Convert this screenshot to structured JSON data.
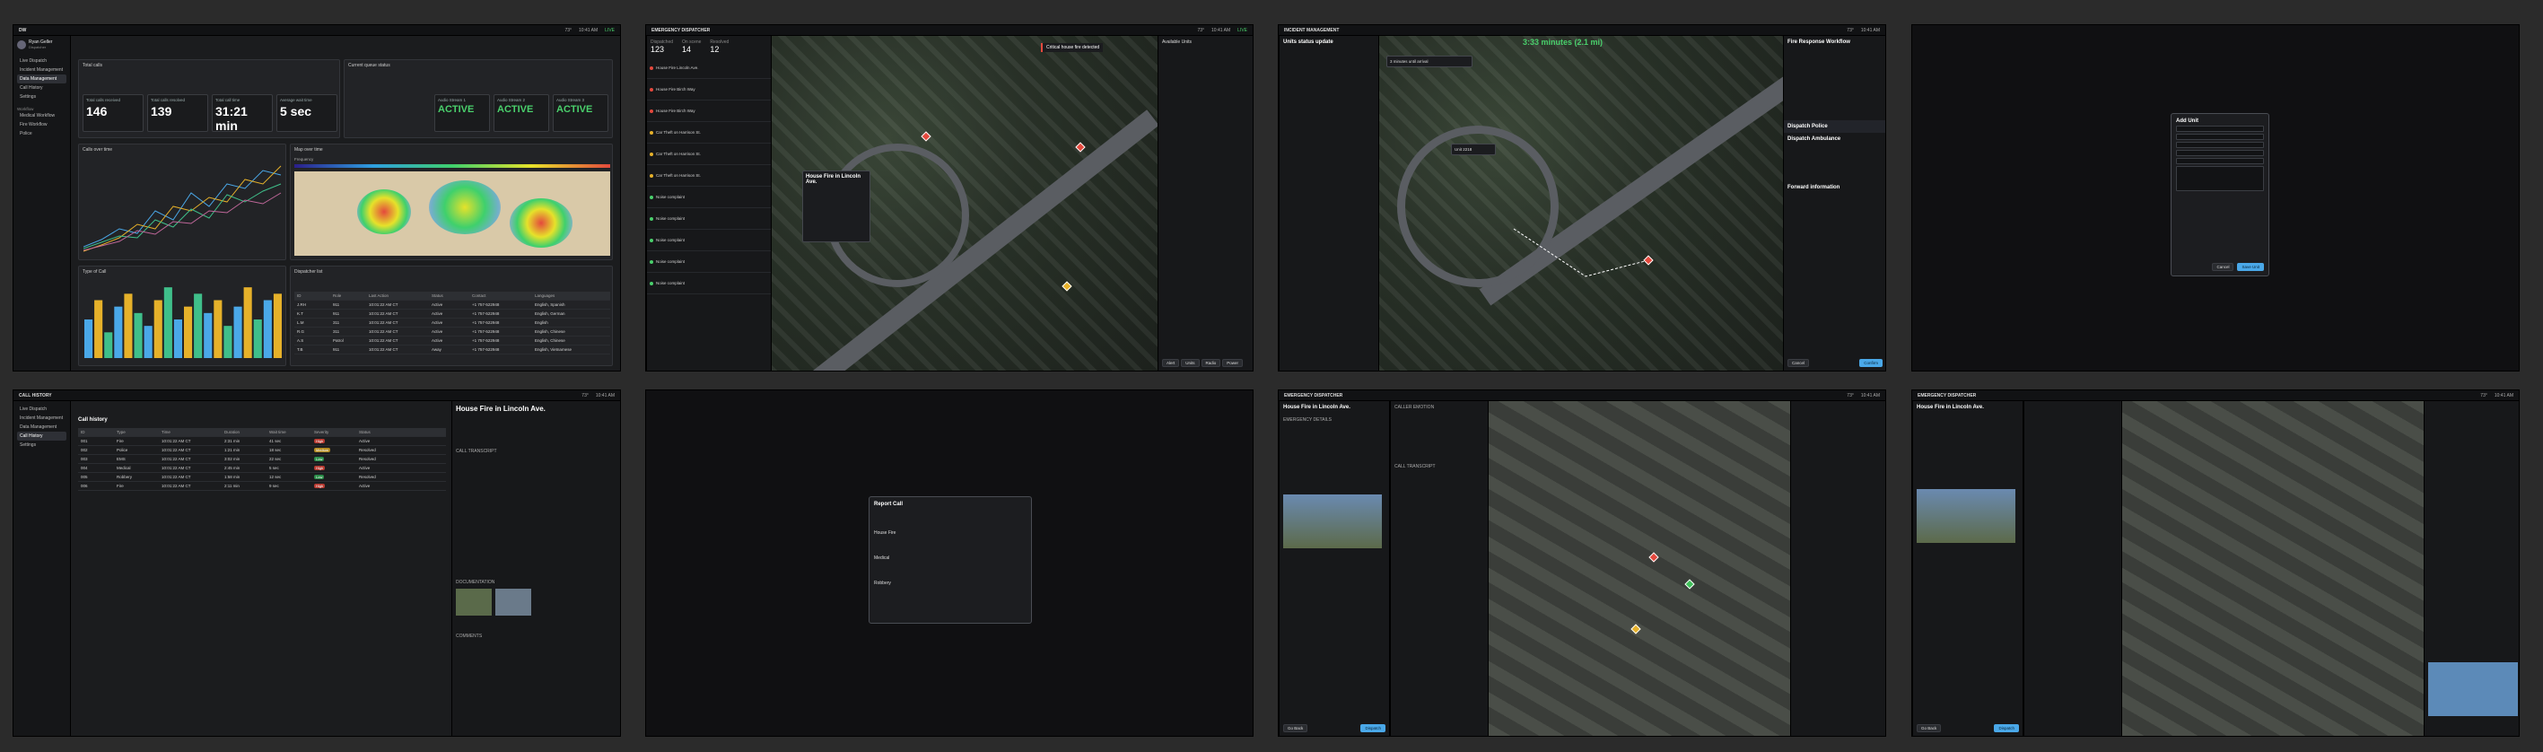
{
  "tiles": {
    "t1": {
      "window_title": "DW",
      "user": {
        "name": "Ryan Geller",
        "role": "Dispatcher"
      },
      "nav": [
        "Live Dispatch",
        "Incident Management",
        "Data Management",
        "Call History",
        "Settings"
      ],
      "nav_section": "Workflow",
      "nav_sub": [
        "Medical Workflow",
        "Fire Workflow",
        "Police"
      ],
      "header_left": "Total calls",
      "header_right": "Current queue status",
      "kpis": [
        {
          "label": "Total calls received",
          "value": "146"
        },
        {
          "label": "Total calls resolved",
          "value": "139"
        },
        {
          "label": "Total call time",
          "value": "31:21 min"
        },
        {
          "label": "Average wait time",
          "value": "5 sec"
        }
      ],
      "queues": [
        {
          "label": "Audio Stream 1",
          "value": "ACTIVE"
        },
        {
          "label": "Audio Stream 2",
          "value": "ACTIVE"
        },
        {
          "label": "Audio Stream 3",
          "value": "ACTIVE"
        }
      ],
      "chart1_title": "Calls over time",
      "chart2_title": "Type of Call",
      "heatmap_title": "Map over time",
      "heatmap_legend": "Frequency",
      "table_title": "Dispatcher list",
      "table_headers": [
        "ID",
        "Role",
        "Last Action",
        "Status",
        "Contact",
        "Languages"
      ],
      "table_rows": [
        [
          "J.RH",
          "911",
          "10:01:22 AM CT",
          "Active",
          "+1 757-522948",
          "English, Spanish"
        ],
        [
          "K.T",
          "911",
          "10:01:22 AM CT",
          "Active",
          "+1 757-522948",
          "English, German"
        ],
        [
          "L.M",
          "311",
          "10:01:22 AM CT",
          "Active",
          "+1 757-522948",
          "English"
        ],
        [
          "R.G",
          "311",
          "10:01:22 AM CT",
          "Active",
          "+1 757-522948",
          "English, Chinese"
        ],
        [
          "A.S",
          "Patrol",
          "10:01:22 AM CT",
          "Active",
          "+1 757-522948",
          "English, Chinese"
        ],
        [
          "T.B",
          "911",
          "10:01:22 AM CT",
          "Away",
          "+1 757-522948",
          "English, Vietnamese"
        ]
      ]
    },
    "t2": {
      "window_title": "EMERGENCY DISPATCHER",
      "stat_labels": [
        "Dispatched",
        "On scene",
        "Resolved"
      ],
      "stat_values": [
        "123",
        "14",
        "12"
      ],
      "alert": "Critical house fire detected",
      "popup_title": "House Fire in Lincoln Ave.",
      "incidents": [
        "House Fire Lincoln Ave.",
        "House Fire Birch Way",
        "House Fire Birch Way",
        "Car Theft on Harrison St.",
        "Car Theft on Harrison St.",
        "Car Theft on Harrison St.",
        "Noise complaint",
        "Noise complaint",
        "Noise complaint",
        "Noise complaint",
        "Noise complaint"
      ],
      "units_title": "Available Units",
      "footer_buttons": [
        "Alert",
        "Units",
        "Radio",
        "Power",
        "Settings"
      ]
    },
    "t3": {
      "window_title": "INCIDENT MANAGEMENT",
      "status_update": "Units status update",
      "eta": "3:33 minutes (2.1 mi)",
      "unit_arrival": "3 minutes until arrival",
      "unit_label": "Unit 2218",
      "workflow_title": "Fire Response Workflow",
      "dispatch": "Dispatch Police",
      "ambulance": "Dispatch Ambulance",
      "forward": "Forward information",
      "btn_cancel": "Cancel",
      "btn_confirm": "Confirm"
    },
    "t4": {
      "modal_title": "Add Unit",
      "btn_cancel": "Cancel",
      "btn_save": "Save Unit"
    },
    "t5": {
      "window_title": "CALL HISTORY",
      "list_title": "Call history",
      "headers": [
        "ID",
        "Type",
        "Time",
        "Duration",
        "Wait time",
        "Severity",
        "Status"
      ],
      "rows": [
        [
          "001",
          "Fire",
          "10:01:22 AM CT",
          "2:31 min",
          "41 sec",
          "High",
          "Active"
        ],
        [
          "002",
          "Police",
          "10:01:22 AM CT",
          "1:21 min",
          "18 sec",
          "Medium",
          "Resolved"
        ],
        [
          "003",
          "EMS",
          "10:01:22 AM CT",
          "3:02 min",
          "22 sec",
          "Low",
          "Resolved"
        ],
        [
          "004",
          "Medical",
          "10:01:22 AM CT",
          "2:45 min",
          "5 sec",
          "High",
          "Active"
        ],
        [
          "005",
          "Robbery",
          "10:01:22 AM CT",
          "1:58 min",
          "12 sec",
          "Low",
          "Resolved"
        ],
        [
          "006",
          "Fire",
          "10:01:22 AM CT",
          "2:11 min",
          "9 sec",
          "High",
          "Active"
        ]
      ],
      "detail_title": "House Fire in Lincoln Ave.",
      "transcript": "CALL TRANSCRIPT",
      "documentation": "DOCUMENTATION",
      "comments": "COMMENTS"
    },
    "t6": {
      "modal_title": "Report Call",
      "items": [
        "House Fire",
        "Medical",
        "Robbery"
      ]
    },
    "t7": {
      "window_title": "EMERGENCY DISPATCHER",
      "title": "House Fire in Lincoln Ave.",
      "section1": "EMERGENCY DETAILS",
      "section2": "CALLER EMOTION",
      "section3": "CALL TRANSCRIPT",
      "btn_cancel": "Go Back",
      "btn_submit": "Dispatch"
    },
    "t8": {
      "window_title": "EMERGENCY DISPATCHER",
      "title": "House Fire in Lincoln Ave.",
      "btn_cancel": "Go Back",
      "btn_submit": "Dispatch"
    }
  },
  "topbar": {
    "weather": "73°",
    "time": "10:41 AM",
    "live": "LIVE"
  },
  "chart_bars": [
    6,
    9,
    4,
    8,
    10,
    7,
    5,
    9,
    11,
    6,
    8,
    10,
    7,
    9,
    5,
    8,
    11,
    6,
    9,
    10
  ],
  "colors": {
    "accent": "#4aa8e8",
    "green": "#4ad06c",
    "red": "#e4493d",
    "yellow": "#e6b12a"
  }
}
